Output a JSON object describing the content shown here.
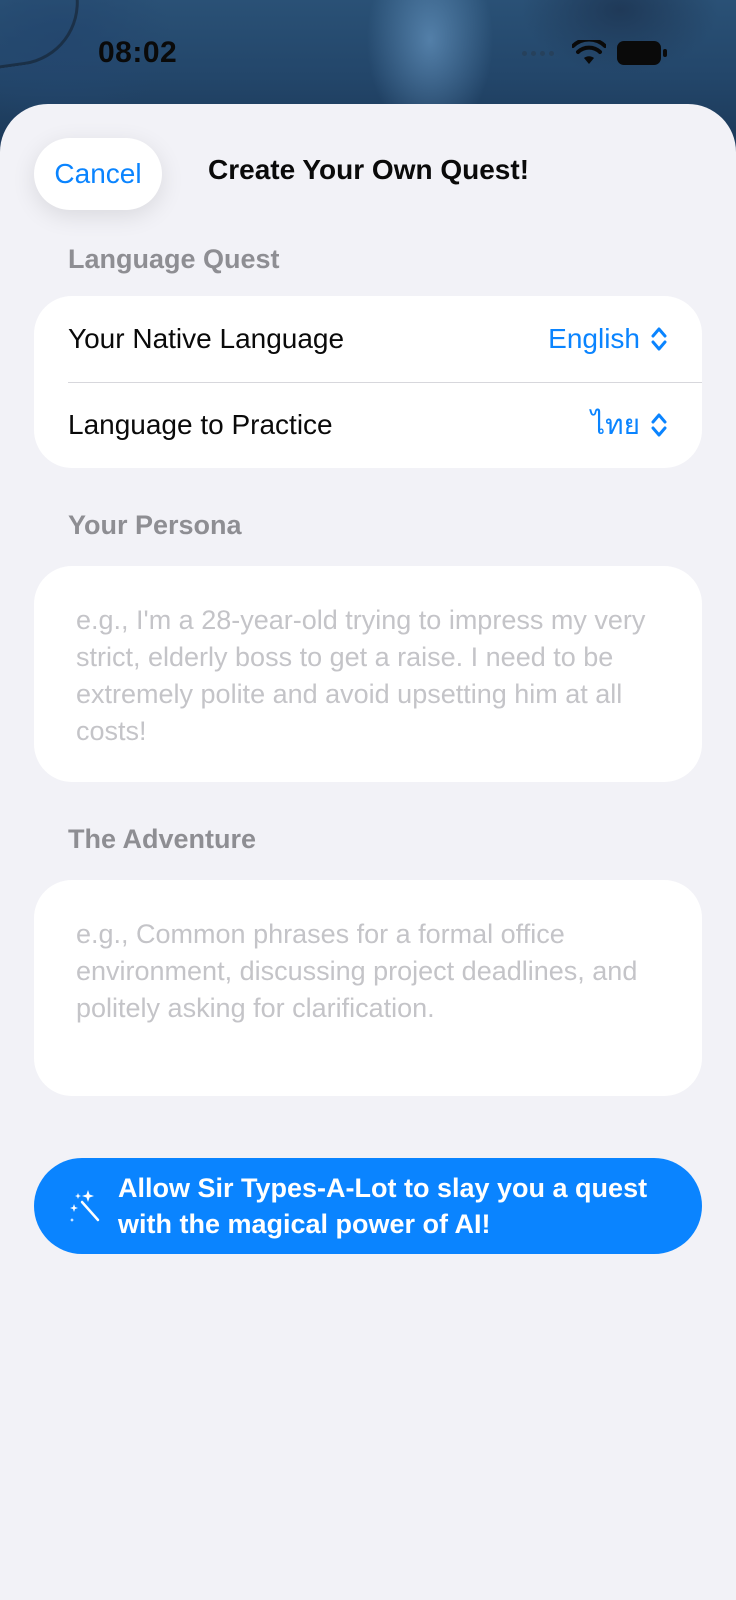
{
  "status_bar": {
    "time": "08:02"
  },
  "sheet": {
    "cancel_label": "Cancel",
    "title": "Create Your Own Quest!"
  },
  "language_quest": {
    "header": "Language Quest",
    "native": {
      "label": "Your Native Language",
      "value": "English"
    },
    "practice": {
      "label": "Language to Practice",
      "value": "ไทย"
    }
  },
  "persona": {
    "header": "Your Persona",
    "placeholder": "e.g., I'm a 28-year-old trying to impress my very strict, elderly boss to get a raise. I need to be extremely polite and avoid upsetting him at all costs!"
  },
  "adventure": {
    "header": "The Adventure",
    "placeholder": "e.g., Common phrases for a formal office environment, discussing project deadlines, and politely asking for clarification."
  },
  "ai_button": {
    "label": "Allow Sir Types-A-Lot to slay you a quest with the magical power of AI!"
  },
  "icons": {
    "wifi": "wifi-icon",
    "battery": "battery-icon",
    "chevron": "chevron-up-down-icon",
    "magic": "magic-wand-icon"
  },
  "colors": {
    "accent": "#0a84ff",
    "sheet_background": "#f2f2f7",
    "card_background": "#ffffff",
    "section_header": "#8e8e93",
    "placeholder": "#c4c4c8"
  }
}
